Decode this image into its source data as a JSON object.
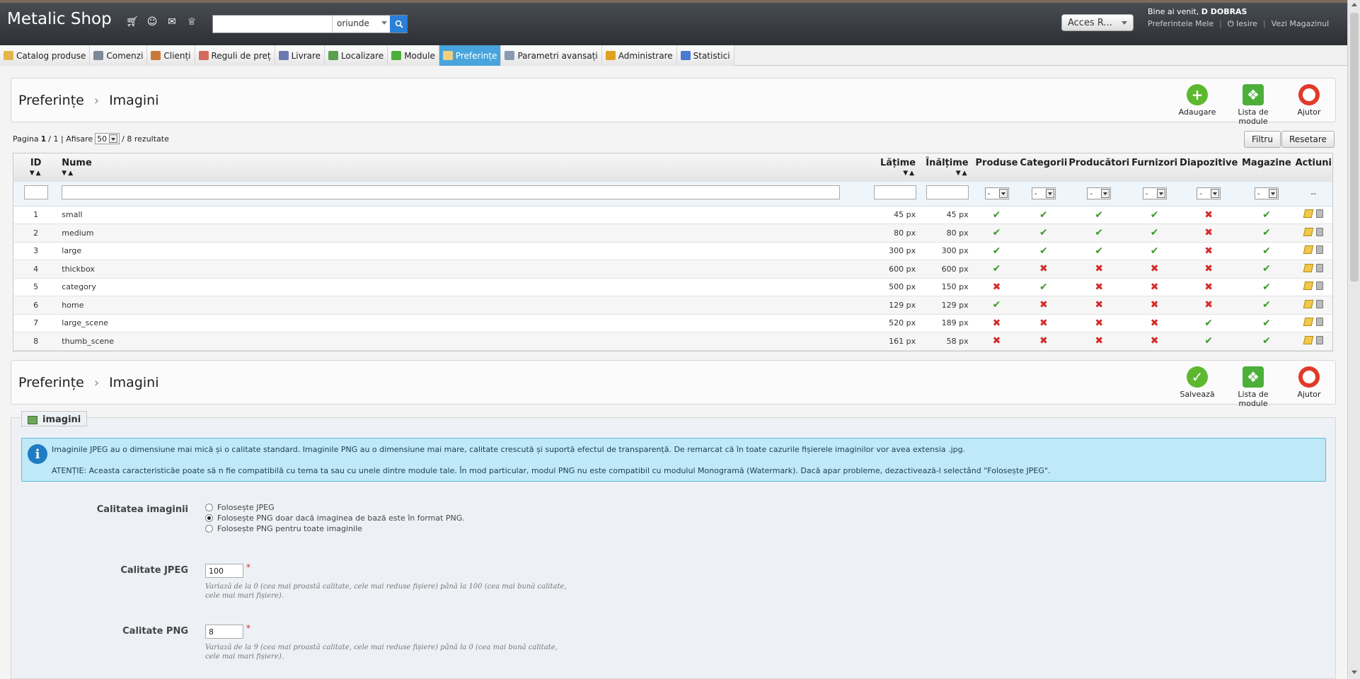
{
  "header": {
    "brand": "Metalic Shop",
    "search_value": "",
    "search_scope": "oriunde",
    "access_button": "Acces R...",
    "welcome_prefix": "Bine ai venit,",
    "welcome_user": "D DOBRAS",
    "links": [
      "Preferintele Mele",
      "Iesire",
      "Vezi Magazinul"
    ],
    "quick_icons": [
      "cart-icon",
      "users-icon",
      "chat-icon",
      "trophy-icon"
    ]
  },
  "menu": [
    {
      "label": "Catalog produse",
      "icon": "folder-icon",
      "color": "#e3b54a"
    },
    {
      "label": "Comenzi",
      "icon": "cart-icon",
      "color": "#7a8a9a"
    },
    {
      "label": "Clienți",
      "icon": "user-icon",
      "color": "#c97a3a"
    },
    {
      "label": "Reguli de preț",
      "icon": "price-icon",
      "color": "#d46a5a"
    },
    {
      "label": "Livrare",
      "icon": "truck-icon",
      "color": "#6a7ab0"
    },
    {
      "label": "Localizare",
      "icon": "globe-icon",
      "color": "#5aa04a"
    },
    {
      "label": "Module",
      "icon": "puzzle-icon",
      "color": "#4caf3a"
    },
    {
      "label": "Preferințe",
      "icon": "preferences-icon",
      "color": "#f0d080",
      "active": true
    },
    {
      "label": "Parametri avansați",
      "icon": "wrench-icon",
      "color": "#8a9ab0"
    },
    {
      "label": "Administrare",
      "icon": "key-icon",
      "color": "#e0a020"
    },
    {
      "label": "Statistici",
      "icon": "chart-icon",
      "color": "#4a7ad0"
    }
  ],
  "toolbar1": {
    "crumb_root": "Preferințe",
    "crumb_page": "Imagini",
    "buttons": [
      "Adaugare",
      "Lista de module",
      "Ajutor"
    ]
  },
  "pager": {
    "pagina": "Pagina",
    "current": "1",
    "total": "/ 1 | Afisare",
    "per_page": "50",
    "results": "/ 8 rezultate"
  },
  "actions": {
    "filter": "Filtru",
    "reset": "Resetare"
  },
  "table": {
    "columns": [
      "ID",
      "Nume",
      "Lățime",
      "Înălțime",
      "Produse",
      "Categorii",
      "Producători",
      "Furnizori",
      "Diapozitive",
      "Magazine",
      "Actiuni"
    ],
    "filter_select": "-",
    "filter_actions": "--",
    "rows": [
      {
        "id": "1",
        "name": "small",
        "width": "45 px",
        "height": "45 px",
        "flags": [
          true,
          true,
          true,
          true,
          false,
          true
        ]
      },
      {
        "id": "2",
        "name": "medium",
        "width": "80 px",
        "height": "80 px",
        "flags": [
          true,
          true,
          true,
          true,
          false,
          true
        ]
      },
      {
        "id": "3",
        "name": "large",
        "width": "300 px",
        "height": "300 px",
        "flags": [
          true,
          true,
          true,
          true,
          false,
          true
        ]
      },
      {
        "id": "4",
        "name": "thickbox",
        "width": "600 px",
        "height": "600 px",
        "flags": [
          true,
          false,
          false,
          false,
          false,
          true
        ]
      },
      {
        "id": "5",
        "name": "category",
        "width": "500 px",
        "height": "150 px",
        "flags": [
          false,
          true,
          false,
          false,
          false,
          true
        ]
      },
      {
        "id": "6",
        "name": "home",
        "width": "129 px",
        "height": "129 px",
        "flags": [
          true,
          false,
          false,
          false,
          false,
          true
        ]
      },
      {
        "id": "7",
        "name": "large_scene",
        "width": "520 px",
        "height": "189 px",
        "flags": [
          false,
          false,
          false,
          false,
          true,
          true
        ]
      },
      {
        "id": "8",
        "name": "thumb_scene",
        "width": "161 px",
        "height": "58 px",
        "flags": [
          false,
          false,
          false,
          false,
          true,
          true
        ]
      }
    ]
  },
  "toolbar2": {
    "crumb_root": "Preferințe",
    "crumb_page": "Imagini",
    "buttons": [
      "Salvează",
      "Lista de module",
      "Ajutor"
    ]
  },
  "settings": {
    "legend": "imagini",
    "info_line1": "Imaginile JPEG au o dimensiune mai mică și o calitate standard. Imaginile PNG au o dimensiune mai mare, calitate crescută și suportă efectul de transparență. De remarcat că în toate cazurile fișierele imaginilor vor avea extensia .jpg.",
    "info_line2": "ATENȚIE: Aceasta caracteristicăe poate să n fie compatibilă cu tema ta sau cu unele dintre module tale. În mod particular, modul PNG nu este compatibil cu modulul Monogramă (Watermark). Dacă apar probleme, dezactivează-l selectând \"Folosește JPEG\".",
    "quality_label": "Calitatea imaginii",
    "quality_options": [
      {
        "label": "Folosește JPEG",
        "checked": false
      },
      {
        "label": "Folosește PNG doar dacă imaginea de bază este în format PNG.",
        "checked": true
      },
      {
        "label": "Folosește PNG pentru toate imaginile",
        "checked": false
      }
    ],
    "jpeg_label": "Calitate JPEG",
    "jpeg_value": "100",
    "jpeg_hint": "Variază de la 0 (cea mai proastă calitate, cele mai reduse fișiere) până la 100 (cea mai bună calitate, cele mai mari fișiere).",
    "png_label": "Calitate PNG",
    "png_value": "8",
    "png_hint": "Variază de la 9 (cea mai proastă calitate, cele mai reduse fișiere) până la 0 (cea mai bună calitate, cele mai mari fișiere).",
    "required_mark": "*"
  }
}
